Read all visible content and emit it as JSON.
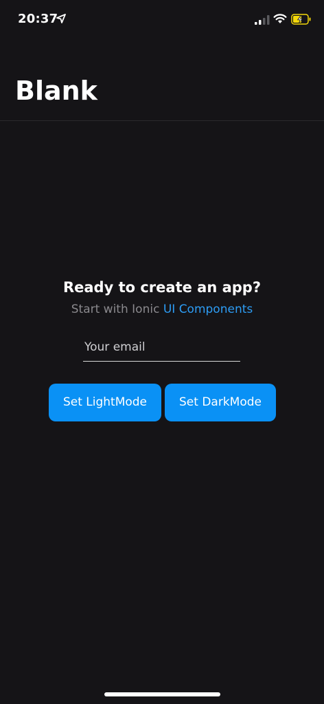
{
  "status_bar": {
    "time": "20:37",
    "icons": [
      "location-arrow-icon",
      "cellular-signal-icon",
      "wifi-icon",
      "battery-charging-icon"
    ]
  },
  "header": {
    "title": "Blank"
  },
  "main": {
    "headline": "Ready to create an app?",
    "subline_prefix": "Start with Ionic ",
    "subline_link": "UI Components",
    "email_placeholder": "Your email",
    "email_value": "",
    "buttons": {
      "light_label": "Set LightMode",
      "dark_label": "Set DarkMode"
    }
  },
  "colors": {
    "background": "#151417",
    "accent": "#0a91f5",
    "link": "#2d9df5",
    "muted_text": "#8a898d",
    "battery_fill": "#f5d90a"
  }
}
